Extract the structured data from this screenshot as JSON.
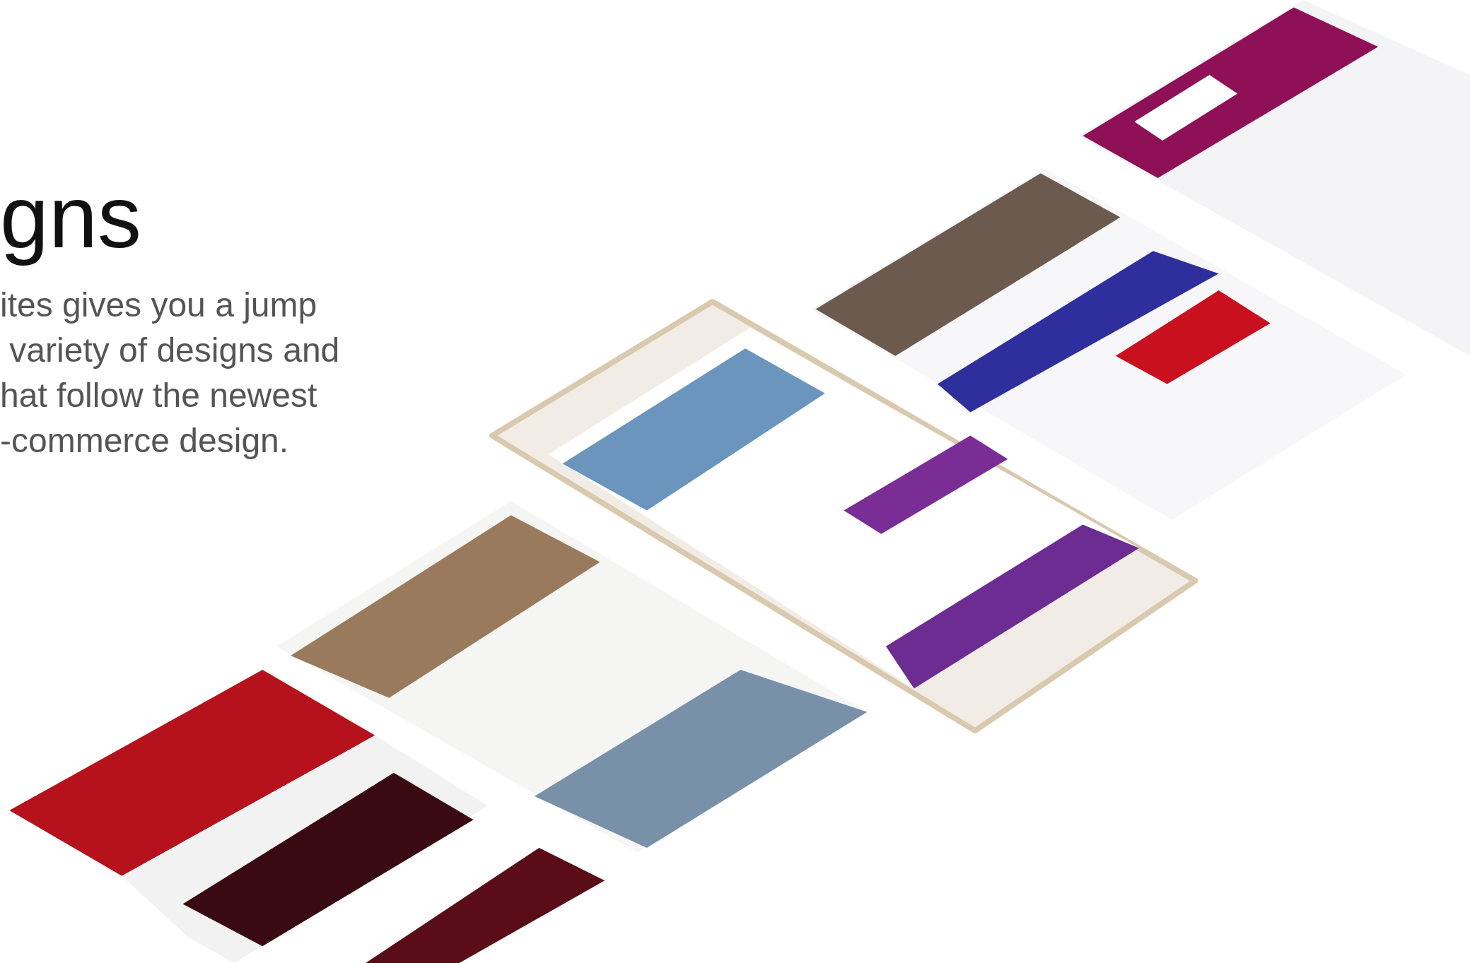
{
  "heading": "gns",
  "intro": {
    "lines": [
      "ites gives you a jump",
      " variety of designs and",
      "hat follow the newest",
      "-commerce design."
    ]
  }
}
